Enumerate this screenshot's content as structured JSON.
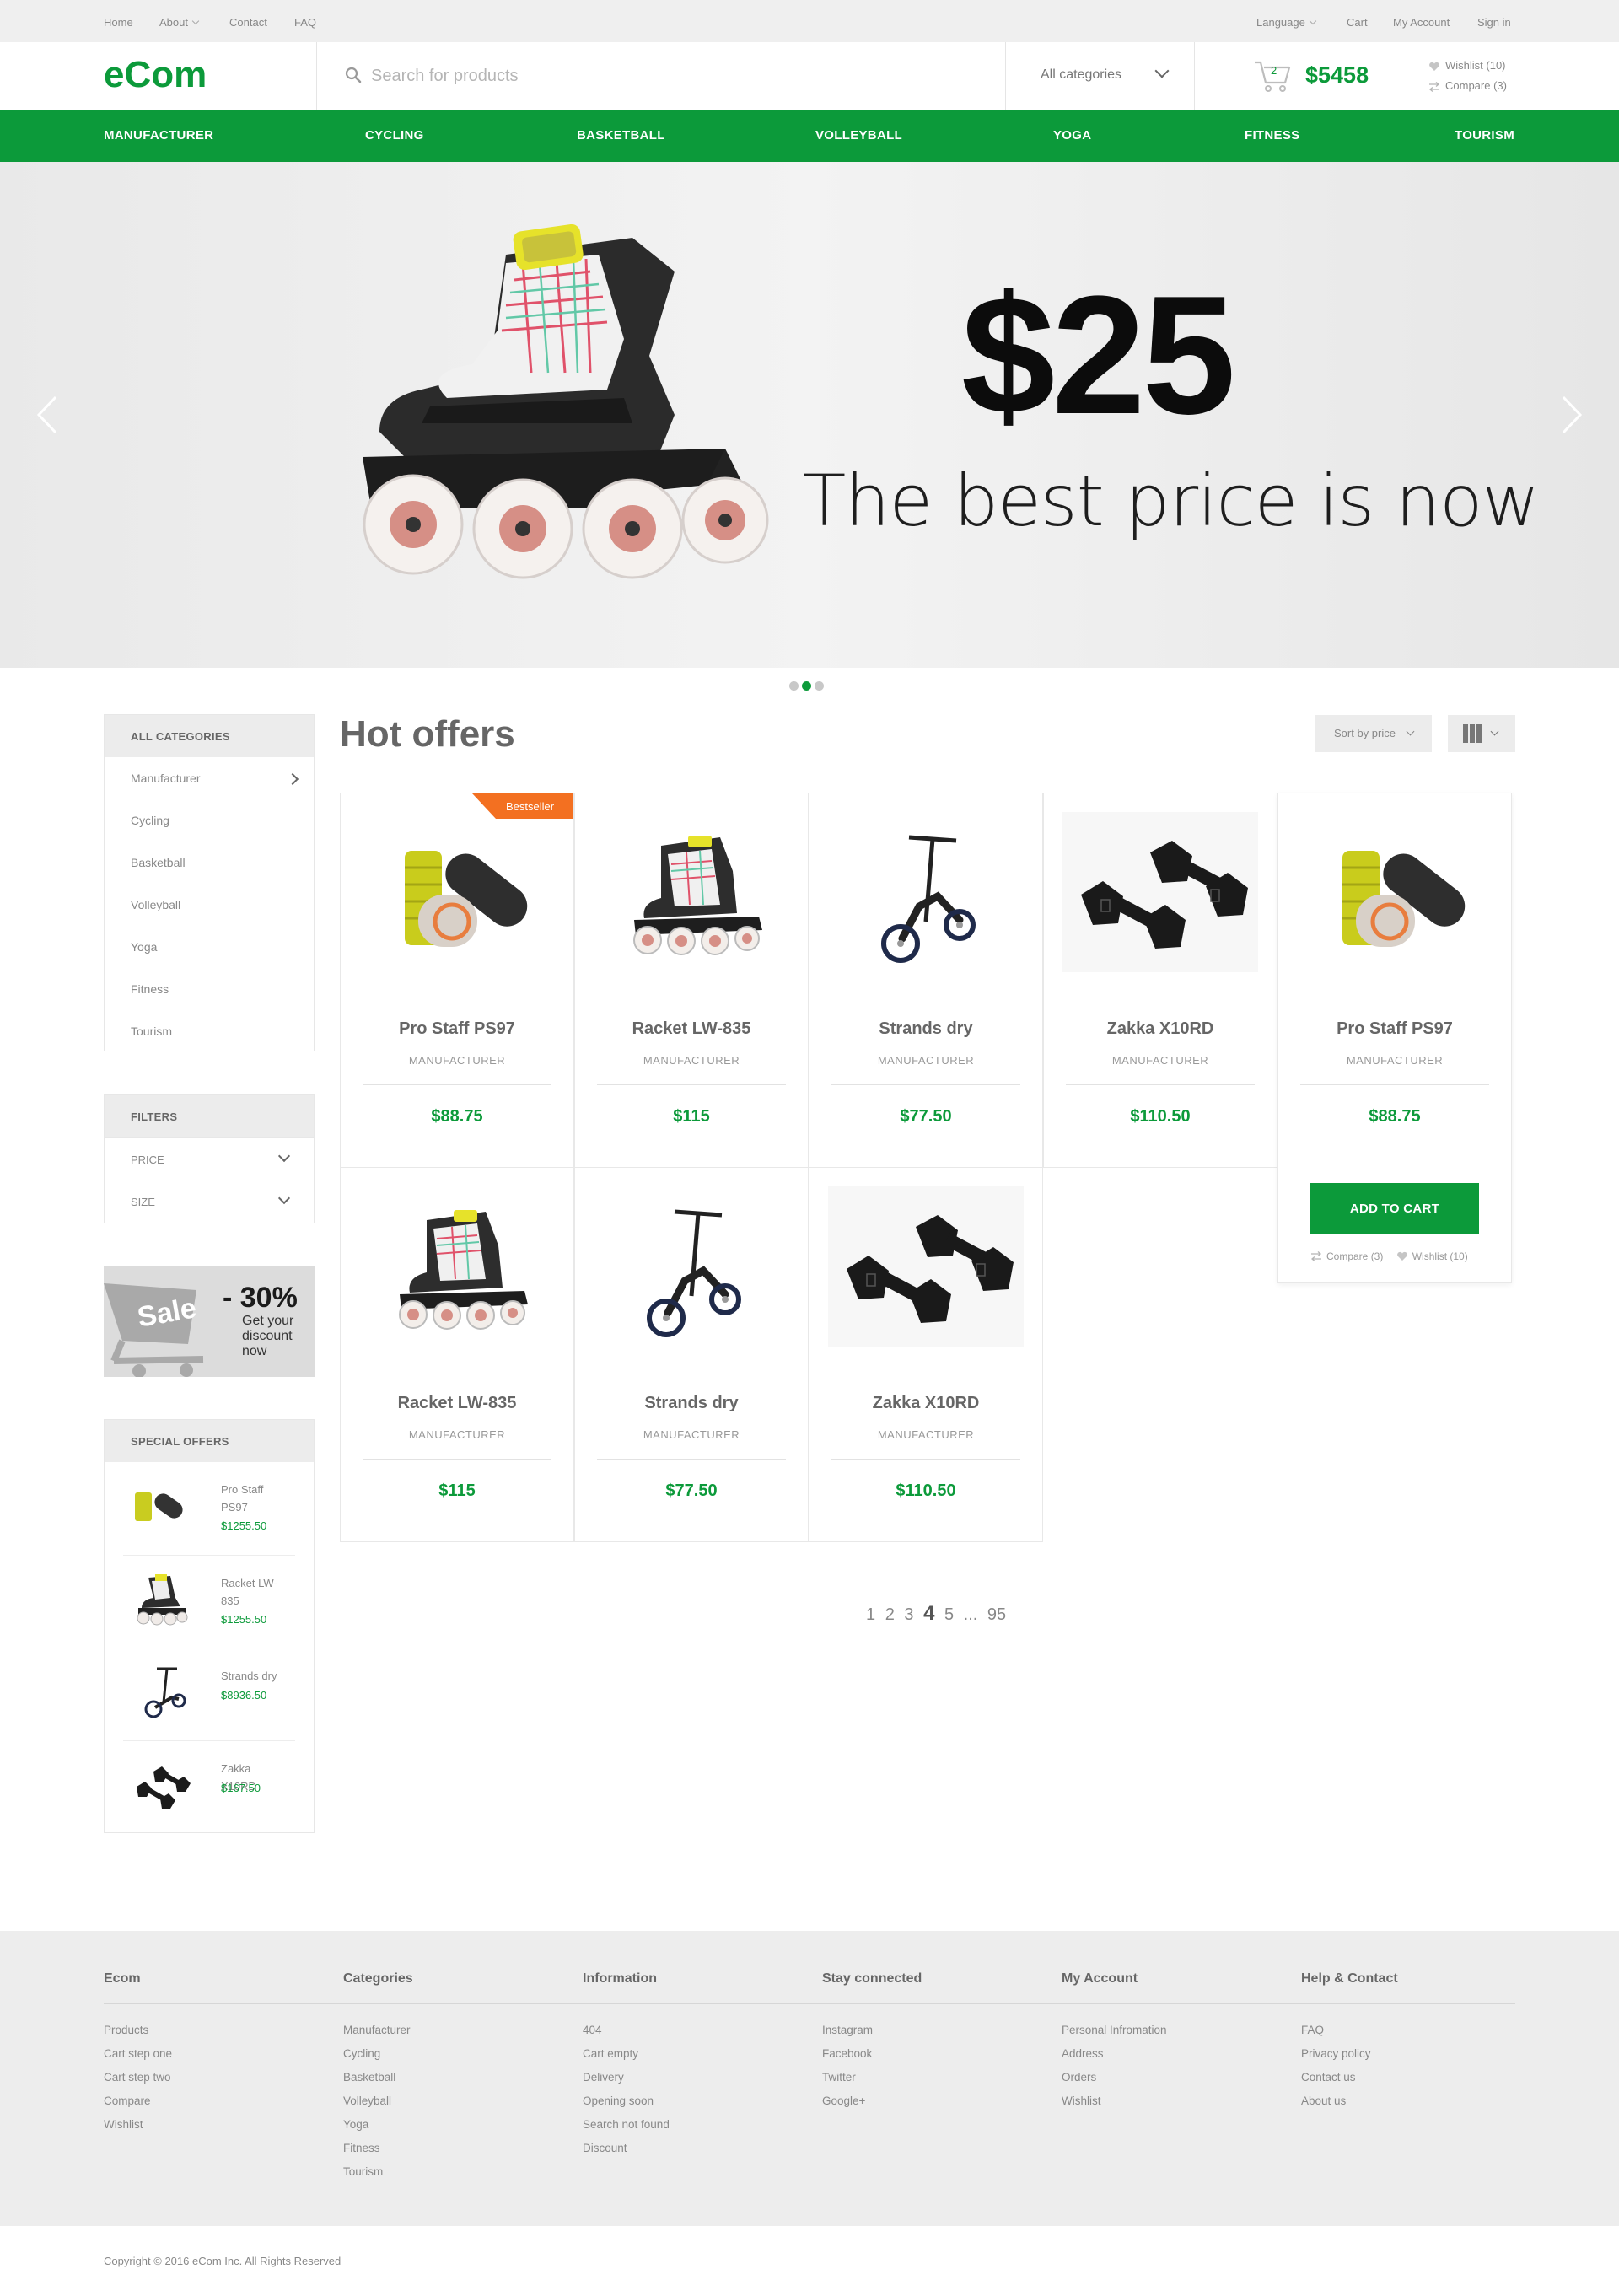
{
  "topbar": {
    "left": [
      "Home",
      "About",
      "Contact",
      "FAQ"
    ],
    "right": [
      "Language",
      "Cart",
      "My Account",
      "Sign in"
    ]
  },
  "header": {
    "logo": "eCom",
    "search_placeholder": "Search for products",
    "category_select": "All categories",
    "cart_count": "2",
    "cart_total": "$5458",
    "wishlist": "Wishlist (10)",
    "compare": "Compare (3)"
  },
  "nav": [
    "MANUFACTURER",
    "CYCLING",
    "BASKETBALL",
    "VOLLEYBALL",
    "YOGA",
    "FITNESS",
    "TOURISM"
  ],
  "hero": {
    "price": "$25",
    "subtitle": "The best price is now",
    "active_slide": 2,
    "slides": 3
  },
  "sidebar": {
    "categories_title": "ALL CATEGORIES",
    "categories": [
      "Manufacturer",
      "Cycling",
      "Basketball",
      "Volleyball",
      "Yoga",
      "Fitness",
      "Tourism"
    ],
    "filters_title": "FILTERS",
    "filters": [
      "PRICE",
      "SIZE"
    ],
    "sale": {
      "label": "Sale",
      "percent": "- 30%",
      "text": "Get your discount now"
    },
    "special_title": "SPECIAL OFFERS",
    "special": [
      {
        "name": "Pro Staff PS97",
        "price": "$1255.50",
        "icon": "foam-roller"
      },
      {
        "name": "Racket LW-835",
        "price": "$1255.50",
        "icon": "inline-skate"
      },
      {
        "name": "Strands dry",
        "price": "$8936.50",
        "icon": "kick-scooter"
      },
      {
        "name": "Zakka X10RD",
        "price": "$167.50",
        "icon": "dumbbells"
      }
    ]
  },
  "main": {
    "title": "Hot offers",
    "sort_label": "Sort by price",
    "products": [
      {
        "name": "Pro Staff PS97",
        "brand": "MANUFACTURER",
        "price": "$88.75",
        "badge": "Bestseller",
        "icon": "foam-roller"
      },
      {
        "name": "Racket LW-835",
        "brand": "MANUFACTURER",
        "price": "$115",
        "icon": "inline-skate"
      },
      {
        "name": "Strands dry",
        "brand": "MANUFACTURER",
        "price": "$77.50",
        "icon": "kick-scooter"
      },
      {
        "name": "Zakka X10RD",
        "brand": "MANUFACTURER",
        "price": "$110.50",
        "icon": "dumbbells"
      },
      {
        "name": "Pro Staff PS97",
        "brand": "MANUFACTURER",
        "price": "$88.75",
        "icon": "foam-roller"
      },
      {
        "name": "Racket LW-835",
        "brand": "MANUFACTURER",
        "price": "$115",
        "icon": "inline-skate"
      },
      {
        "name": "Strands dry",
        "brand": "MANUFACTURER",
        "price": "$77.50",
        "icon": "kick-scooter"
      },
      {
        "name": "Zakka X10RD",
        "brand": "MANUFACTURER",
        "price": "$110.50",
        "icon": "dumbbells"
      }
    ],
    "add_to_cart": "ADD TO CART",
    "card_compare": "Compare (3)",
    "card_wishlist": "Wishlist (10)",
    "pagination": [
      "1",
      "2",
      "3",
      "4",
      "5",
      "...",
      "95"
    ],
    "current_page": "4"
  },
  "footer": {
    "columns": [
      {
        "title": "Ecom",
        "links": [
          "Products",
          "Cart step one",
          "Cart step two",
          "Compare",
          "Wishlist"
        ]
      },
      {
        "title": "Categories",
        "links": [
          "Manufacturer",
          "Cycling",
          "Basketball",
          "Volleyball",
          "Yoga",
          "Fitness",
          "Tourism"
        ]
      },
      {
        "title": "Information",
        "links": [
          "404",
          "Cart empty",
          "Delivery",
          "Opening soon",
          "Search not found",
          "Discount"
        ]
      },
      {
        "title": "Stay connected",
        "links": [
          "Instagram",
          "Facebook",
          "Twitter",
          "Google+"
        ]
      },
      {
        "title": "My Account",
        "links": [
          "Personal Infromation",
          "Address",
          "Orders",
          "Wishlist"
        ]
      },
      {
        "title": "Help & Contact",
        "links": [
          "FAQ",
          "Privacy policy",
          "Contact us",
          "About us"
        ]
      }
    ],
    "copyright": "Copyright © 2016 eCom Inc. All Rights Reserved"
  },
  "colors": {
    "brand_green": "#0c9a3a",
    "badge_orange": "#f37021"
  }
}
